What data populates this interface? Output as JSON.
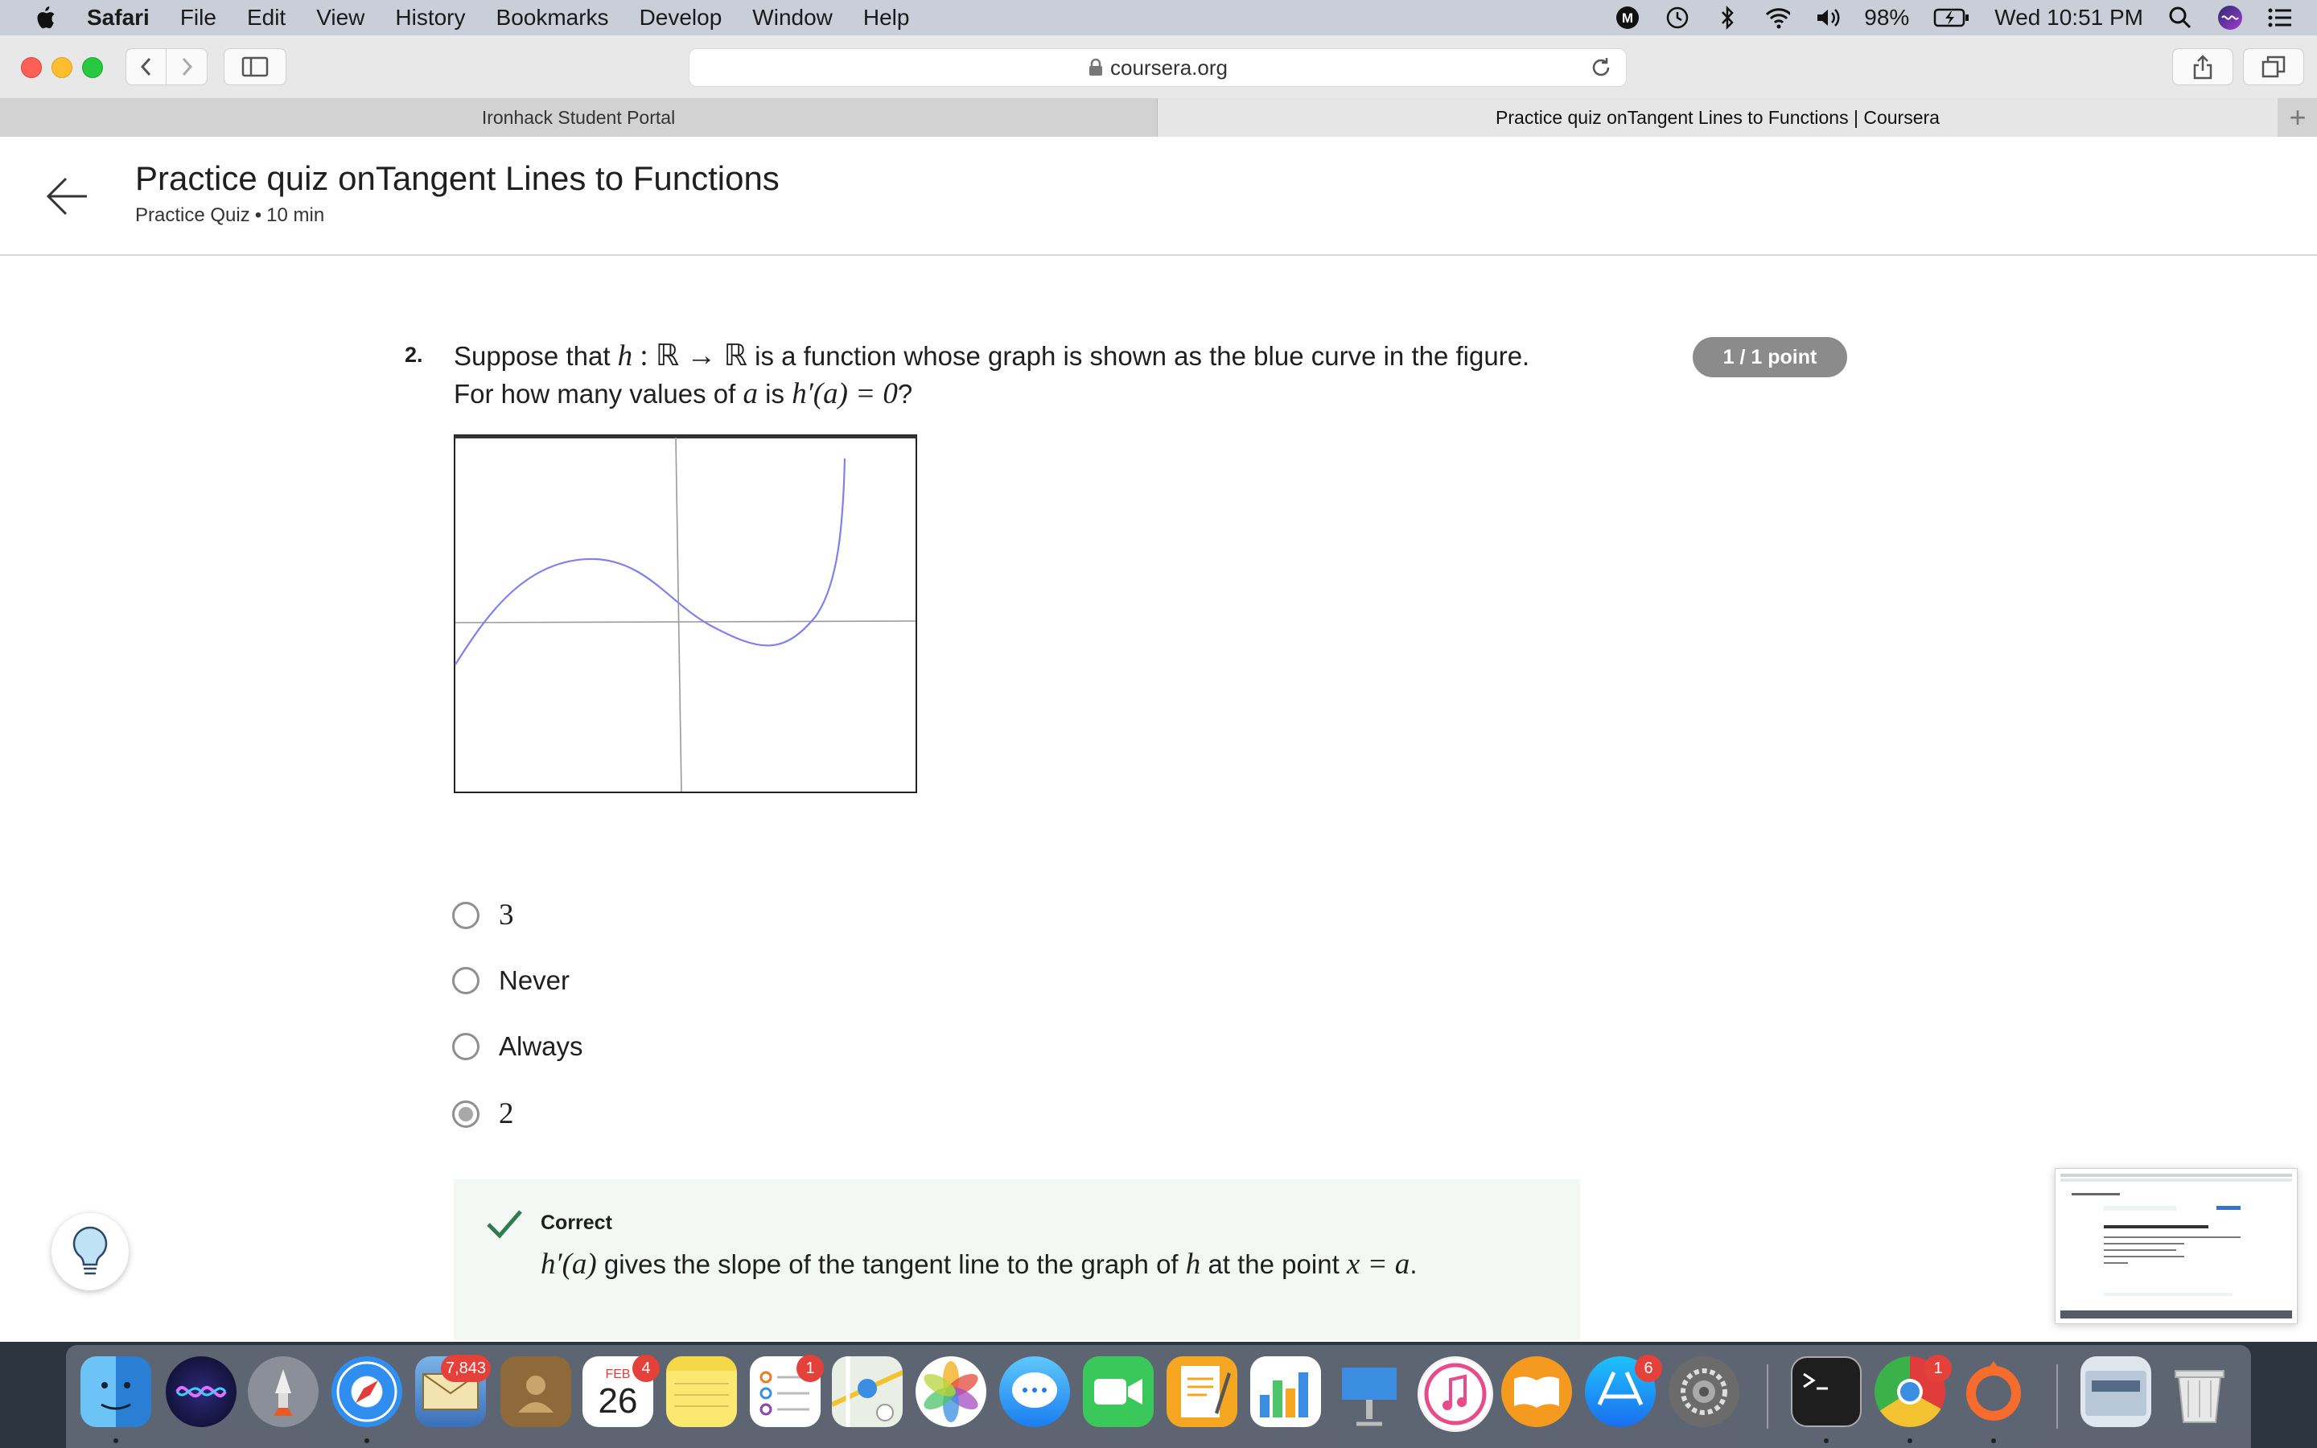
{
  "menubar": {
    "app_name": "Safari",
    "items": [
      "File",
      "Edit",
      "View",
      "History",
      "Bookmarks",
      "Develop",
      "Window",
      "Help"
    ],
    "battery": "98%",
    "clock": "Wed 10:51 PM"
  },
  "browser": {
    "url": "coursera.org",
    "tabs": [
      {
        "label": "Ironhack Student Portal",
        "active": false
      },
      {
        "label": "Practice quiz onTangent Lines to Functions | Coursera",
        "active": true
      }
    ],
    "new_tab": "+"
  },
  "header": {
    "title": "Practice quiz onTangent Lines to Functions",
    "type": "Practice Quiz",
    "separator": "•",
    "duration": "10 min"
  },
  "question": {
    "number": "2.",
    "line1_pre": "Suppose that",
    "math_h": "h",
    "math_map": ": ℝ → ℝ",
    "line1_post": "is a function whose graph is shown as the blue curve in the figure.",
    "line2_pre": "For how many values of",
    "math_a": "a",
    "line2_mid": "is",
    "math_deriv": "h′(a) = 0",
    "line2_post": "?",
    "points": "1 / 1 point",
    "options": [
      {
        "label": "3",
        "selected": false
      },
      {
        "label": "Never",
        "selected": false
      },
      {
        "label": "Always",
        "selected": false
      },
      {
        "label": "2",
        "selected": true
      }
    ]
  },
  "feedback": {
    "title": "Correct",
    "math_deriv": "h′(a)",
    "text_mid": "gives the slope of the tangent line to the graph of",
    "math_h": "h",
    "text_mid2": "at the point",
    "math_point": "x = a",
    "text_end": "."
  },
  "dock": {
    "badges": {
      "mail": "7,843",
      "calendar": "4",
      "reminders": "1",
      "appstore": "6",
      "chrome": "1"
    },
    "calendar_month": "FEB",
    "calendar_day": "26"
  },
  "colors": {
    "curve": "#8080ee",
    "points_badge": "#8b8b8b",
    "feedback_bg": "#f3f8f4",
    "check": "#2f7d4f"
  }
}
